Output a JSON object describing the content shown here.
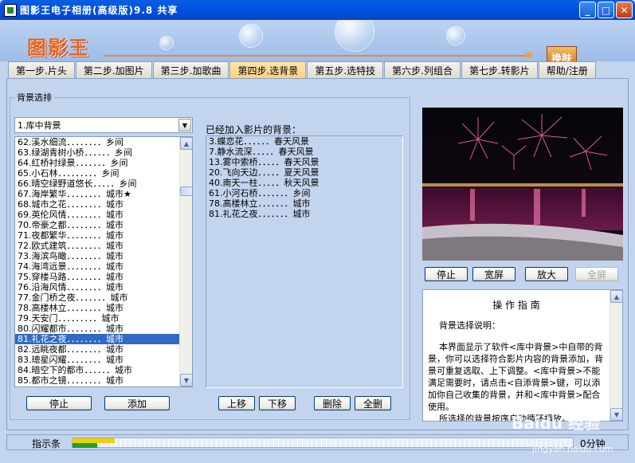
{
  "window": {
    "title": "图影王电子相册(高级版)9.8 共享",
    "min": "_",
    "max": "□",
    "close": "✕"
  },
  "banner": {
    "logo": "图影王",
    "skin_button": "换肤"
  },
  "tabs": [
    {
      "label": "第一步.片头"
    },
    {
      "label": "第二步.加图片"
    },
    {
      "label": "第三步.加歌曲"
    },
    {
      "label": "第四步.选背景",
      "active": true
    },
    {
      "label": "第五步.选特技"
    },
    {
      "label": "第六步.列组合"
    },
    {
      "label": "第七步.转影片"
    },
    {
      "label": "帮助/注册"
    }
  ],
  "background_group": {
    "label": "背景选排",
    "combo_value": "1.库中背景",
    "list": [
      "62.溪水细流．．．．．．．．乡间",
      "63.绿湖青树小桥．．．．．．乡间",
      "64.红桥衬绿景．．．．．．．乡间",
      "65.小石林．．．．．．．．．乡间",
      "66.晴空绿野道悠长．．．．．乡间",
      "67.海岸繁华．．．．．．．．城市★",
      "68.城市之花．．．．．．．．城市",
      "69.英伦风情．．．．．．．．城市",
      "70.帝豪之都．．．．．．．．城市",
      "71.夜都繁华．．．．．．．．城市",
      "72.欧式建筑．．．．．．．．城市",
      "73.海滨鸟瞰．．．．．．．．城市",
      "74.海湾远景．．．．．．．．城市",
      "75.穿楼马路．．．．．．．．城市",
      "76.沿海风情．．．．．．．．城市",
      "77.金门桥之夜．．．．．．．城市",
      "78.高楼林立．．．．．．．．城市",
      "79.天安门．．．．．．．．．城市",
      "80.闪耀都市．．．．．．．．城市",
      "81.礼花之夜．．．．．．．．城市",
      "82.远眺夜都．．．．．．．．城市",
      "83.璁星闪耀．．．．．．．．城市",
      "84.暗空下的都市．．．．．．城市",
      "85.都市之镜．．．．．．．．城市"
    ],
    "selected_index": 19,
    "stop_button": "停止",
    "add_button": "添加"
  },
  "added": {
    "label": "已经加入影片的背景：",
    "list": [
      "3.蝶恋花．．．．．．春天风景",
      "7.静水流深．．．．．春天风景",
      "13.雾中索桥．．．．．春天风景",
      "20.飞向天边．．．．．夏天风景",
      "40.南天一柱．．．．．秋天风景",
      "61.小河石桥．．．．．．．乡间",
      "78.高楼林立．．．．．．．城市",
      "81.礼花之夜．．．．．．．城市"
    ],
    "up_button": "上移",
    "down_button": "下移",
    "delete_button": "删除",
    "clear_button": "全删"
  },
  "preview": {
    "stop": "停止",
    "wide": "宽屏",
    "zoom": "放大",
    "fullscreen": "全屏"
  },
  "guide": {
    "title": "操 作 指 南",
    "subtitle": "背景选择说明：",
    "body": "本界面显示了软件<库中背景>中自带的背景，你可以选择符合影片内容的背景添加，背景可重复选取、上下调整。<库中背景>不能满足需要时，请点击<自添背景>键，可以添加你自己收集的背景，并和<库中背景>配合使用。",
    "last": "所选择的背景按序自动循环播放。"
  },
  "status": {
    "label": "指示条",
    "time": "0分钟",
    "progress_yellow": 0.085,
    "progress_green": 0.05
  },
  "watermark": {
    "brand": "Baidu 经验",
    "url": "jingyan.baidu.com"
  }
}
